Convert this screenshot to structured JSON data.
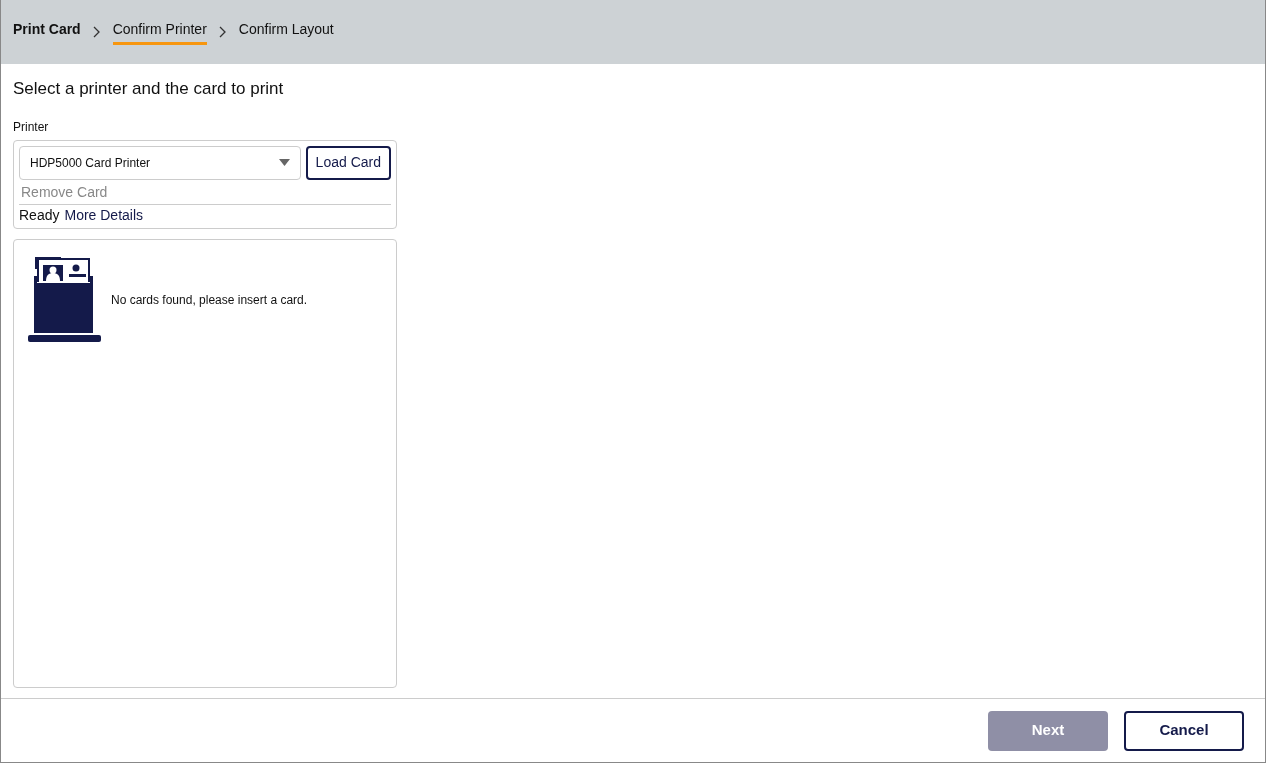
{
  "breadcrumb": [
    {
      "label": "Print Card",
      "kind": "root",
      "selected": false
    },
    {
      "label": "Confirm Printer",
      "kind": "step",
      "selected": true
    },
    {
      "label": "Confirm Layout",
      "kind": "step",
      "selected": false
    }
  ],
  "heading": "Select a printer and the card to print",
  "printer": {
    "label": "Printer",
    "value": "HDP5000 Card Printer",
    "load_button": "Load Card",
    "remove_button": {
      "label": "Remove Card",
      "disabled": true
    },
    "status": "Ready",
    "details_link": "More Details"
  },
  "cards": {
    "message": "No cards found, please insert a card."
  },
  "footer": {
    "buttons": [
      {
        "label": "Next",
        "kind": "primary",
        "disabled": true
      },
      {
        "label": "Cancel",
        "kind": "secondary",
        "disabled": false
      }
    ]
  }
}
